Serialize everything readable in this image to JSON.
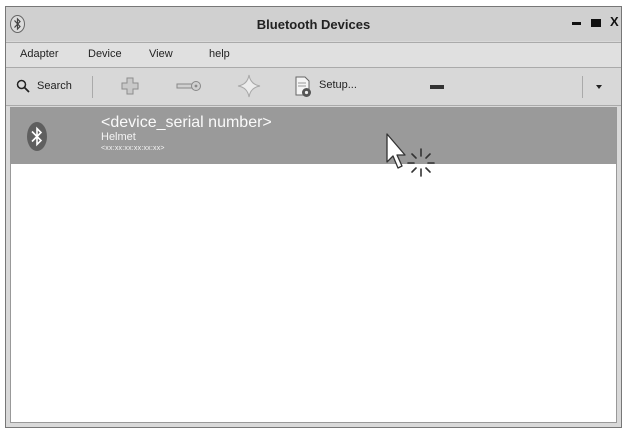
{
  "window": {
    "title": "Bluetooth Devices",
    "close_label": "X"
  },
  "menu": {
    "items": [
      "Adapter",
      "Device",
      "View",
      "help"
    ]
  },
  "toolbar": {
    "search_label": "Search",
    "setup_label": "Setup..."
  },
  "device": {
    "name": "<device_serial number>",
    "type": "Helmet",
    "address": "<xx:xx:xx:xx:xx:xx>"
  },
  "colors": {
    "selected_row": "#9a9a9a",
    "window_bg": "#d9d9d9",
    "list_bg": "#ffffff"
  },
  "icons": [
    "bluetooth-icon",
    "search-icon",
    "add-device-icon",
    "pair-key-icon",
    "trust-icon",
    "setup-icon",
    "remove-device-icon",
    "dropdown-chevron-icon",
    "click-pointer-icon"
  ]
}
